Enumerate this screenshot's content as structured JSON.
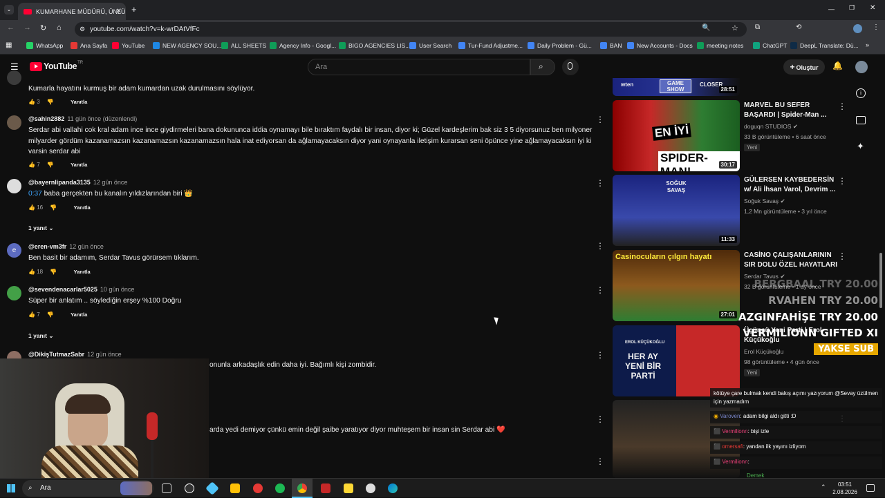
{
  "browser": {
    "tab_title": "KUMARHANE MÜDÜRÜ, ÜNLÜ",
    "url": "youtube.com/watch?v=k-wrDAtVfFc",
    "bookmarks": [
      {
        "label": "WhatsApp",
        "color": "#25d366"
      },
      {
        "label": "Ana Sayfa",
        "color": "#e53935"
      },
      {
        "label": "YouTube",
        "color": "#ff0033"
      },
      {
        "label": "NEW AGENCY SOU...",
        "color": "#1e88e5"
      },
      {
        "label": "ALL SHEETS",
        "color": "#0f9d58"
      },
      {
        "label": "Agency Info - Googl...",
        "color": "#0f9d58"
      },
      {
        "label": "BIGO AGENCIES LIS...",
        "color": "#0f9d58"
      },
      {
        "label": "User Search",
        "color": "#4285f4"
      },
      {
        "label": "Tur-Fund Adjustme...",
        "color": "#4285f4"
      },
      {
        "label": "Daily Problem - Gü...",
        "color": "#4285f4"
      },
      {
        "label": "BAN",
        "color": "#4285f4"
      },
      {
        "label": "New Accounts - Docs",
        "color": "#4285f4"
      },
      {
        "label": "meeting notes",
        "color": "#0f9d58"
      },
      {
        "label": "ChatGPT",
        "color": "#10a37f"
      },
      {
        "label": "DeepL Translate: Dü...",
        "color": "#0f2b46"
      }
    ]
  },
  "youtube": {
    "logo": "YouTube",
    "logo_country": "TR",
    "search_placeholder": "Ara",
    "create_label": "Oluştur"
  },
  "comments": [
    {
      "handle": "",
      "time": "",
      "text": "Kumarla hayatını kurmuş bir adam kumardan uzak durulmasını söylüyor.",
      "likes": "3",
      "reply": "Yanıtla"
    },
    {
      "handle": "@sahin2882",
      "time": "11 gün önce (düzenlendi)",
      "text": "Serdar abi vallahi cok kral adam ince ince giydirmeleri bana dokununca iddia oynamayı bile bıraktım faydalı bir insan, diyor ki; Güzel kardeşlerim bak siz 3 5 diyorsunuz ben milyoner milyarder gördüm kazanamazsın kazanamazsın kazanamazsın hala inat ediyorsan da ağlamayacaksın diyor yani oynayanla iletişim kurarsan seni öpünce yine ağlamayacaksın iyi ki varsin serdar abi",
      "likes": "7",
      "reply": "Yanıtla"
    },
    {
      "handle": "@bayernlipanda3135",
      "time": "12 gün önce",
      "timestamp_link": "0:37",
      "text": "baba gerçekten bu kanalın yıldızlarından biri 👑",
      "likes": "16",
      "reply": "Yanıtla",
      "replies_label": "1 yanıt"
    },
    {
      "handle": "@eren-vm3fr",
      "time": "12 gün önce",
      "text": "Ben basit bir adamım, Serdar Tavus görürsem tıklarım.",
      "likes": "18",
      "reply": "Yanıtla"
    },
    {
      "handle": "@sevendenacarlar5025",
      "time": "10 gün önce",
      "text": "Süper bir anlatım .. söylediğin erşey  %100 Doğru",
      "likes": "7",
      "reply": "Yanıtla",
      "replies_label": "1 yanıt"
    },
    {
      "handle": "@DikişTutmazSabr",
      "time": "12 gün önce",
      "text": "onunla arkadaşlık edin daha iyi. Bağımlı kişi zombidir.",
      "likes": "",
      "reply": ""
    },
    {
      "handle": "",
      "time": "",
      "text": "arda yedi demiyor çünkü emin değil şaibe yaratıyor diyor muhteşem bir insan sin Serdar abi ❤️",
      "likes": "",
      "reply": ""
    }
  ],
  "sidebar": {
    "videos": [
      {
        "title": "",
        "channel": "",
        "meta": "",
        "duration": "28:51",
        "thumb_text": "GAME SHOW",
        "thumb_sub": "CLOSER",
        "thumb_left": "wten"
      },
      {
        "title": "MARVEL BU SEFER BAŞARDI | Spider-Man ...",
        "channel": "doguqn STUDIOS",
        "meta": "33 B görüntüleme • 6 saat önce",
        "badge": "Yeni",
        "duration": "30:17",
        "thumb_text": "EN İYİ",
        "thumb_sub": "SPIDER-MAN!"
      },
      {
        "title": "GÜLERSEN KAYBEDERSİN w/ Ali İhsan Varol, Devrim ...",
        "channel": "Soğuk Savaş",
        "meta": "1,2 Mn görüntüleme • 3 yıl önce",
        "duration": "11:33",
        "thumb_text": "SOĞUK SAVAŞ"
      },
      {
        "title": "CASİNO ÇALIŞANLARININ SIR DOLU ÖZEL HAYATLARI",
        "channel": "Serdar Tavus",
        "meta": "32 B görüntüleme • 1 ay önce",
        "duration": "27:01",
        "thumb_text": "Casinocuların çılgın hayatı"
      },
      {
        "title": "Üçüncü Yeni Parti | Erol Küçükoğlu",
        "channel": "Erol Küçükoğlu",
        "meta": "98 görüntüleme • 4 gün önce",
        "badge": "Yeni",
        "duration": "",
        "thumb_text": "HER AY YENİ BİR PARTİ",
        "thumb_sub": "EROL KÜÇÜKOĞLU"
      },
      {
        "title": "",
        "channel": "",
        "meta": "",
        "badge": "Demek",
        "duration": ""
      }
    ]
  },
  "overlay": {
    "donations": [
      {
        "text": "BERGBAAL TRY 20.00"
      },
      {
        "text": "RVAHEN  TRY 20.00"
      },
      {
        "text": "AZGINFAHİŞE  TRY 20.00"
      },
      {
        "text": "VERMILIONN  GIFTED XI"
      },
      {
        "text": "YAKSE  SUB"
      }
    ],
    "chat": [
      {
        "user": "",
        "text": "kötüye çare bulmak kendi bakış açımı yazıyorum @Sevay üzülmen için yazmadım"
      },
      {
        "user": "Varoven",
        "text": ": adam bilgi aldı gitti :D"
      },
      {
        "user": "Vermilionn",
        "text": ": bişi izle"
      },
      {
        "user": "omersafi",
        "text": ": yandan ilk yayını izliyom"
      },
      {
        "user": "Vermilionn",
        "text": ":"
      }
    ]
  },
  "taskbar": {
    "search_placeholder": "Ara",
    "time": "03:51",
    "date": "2.08.2026"
  }
}
